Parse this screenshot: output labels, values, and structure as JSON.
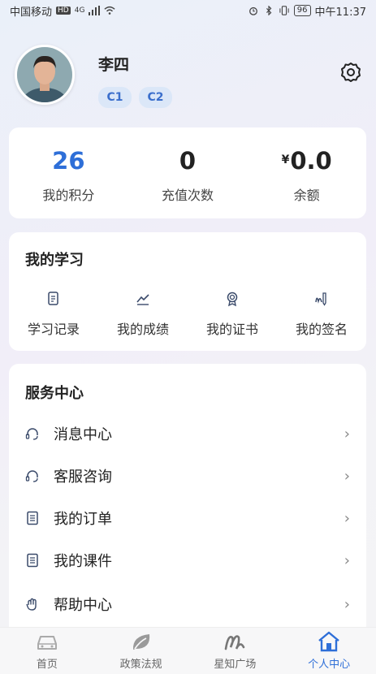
{
  "status_bar": {
    "carrier": "中国移动",
    "hd": "HD",
    "signal": "4G",
    "battery": "96",
    "time": "中午11:37"
  },
  "profile": {
    "name": "李四",
    "tags": [
      "C1",
      "C2"
    ]
  },
  "stats": [
    {
      "value": "26",
      "label": "我的积分"
    },
    {
      "value": "0",
      "label": "充值次数"
    },
    {
      "currency": "¥",
      "value": "0.0",
      "label": "余额"
    }
  ],
  "study": {
    "title": "我的学习",
    "items": [
      {
        "label": "学习记录",
        "icon": "document-icon"
      },
      {
        "label": "我的成绩",
        "icon": "trend-icon"
      },
      {
        "label": "我的证书",
        "icon": "badge-icon"
      },
      {
        "label": "我的签名",
        "icon": "pen-icon"
      }
    ]
  },
  "service": {
    "title": "服务中心",
    "items": [
      {
        "label": "消息中心",
        "icon": "headset-icon"
      },
      {
        "label": "客服咨询",
        "icon": "headset-icon"
      },
      {
        "label": "我的订单",
        "icon": "list-icon"
      },
      {
        "label": "我的课件",
        "icon": "list-icon"
      },
      {
        "label": "帮助中心",
        "icon": "hand-icon"
      }
    ],
    "chevron": "›"
  },
  "tabbar": {
    "items": [
      {
        "label": "首页",
        "icon": "car-icon"
      },
      {
        "label": "政策法规",
        "icon": "leaf-icon"
      },
      {
        "label": "星知广场",
        "icon": "scribble-icon"
      },
      {
        "label": "个人中心",
        "icon": "house-icon",
        "active": true
      }
    ]
  },
  "colors": {
    "accent": "#2e6fd8",
    "tag_bg": "#dbe7f8"
  }
}
